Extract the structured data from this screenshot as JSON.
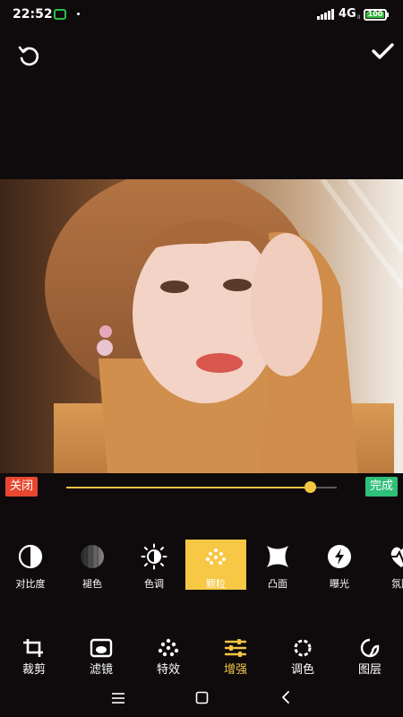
{
  "status": {
    "time": "22:52",
    "network": "4G",
    "network_sub": "II",
    "battery": "100",
    "battery_level": 1.0
  },
  "top_bar": {
    "undo_icon": "undo-icon",
    "confirm_icon": "check-icon"
  },
  "photo": {
    "description_icon": "photo-canvas"
  },
  "slider": {
    "close_label": "关闭",
    "done_label": "完成",
    "value": 0.9
  },
  "tools": [
    {
      "label": "对比度",
      "icon": "contrast-icon"
    },
    {
      "label": "褪色",
      "icon": "fade-icon"
    },
    {
      "label": "色调",
      "icon": "tone-icon"
    },
    {
      "label": "颗粒",
      "icon": "grain-icon",
      "active": true
    },
    {
      "label": "凸面",
      "icon": "convex-icon"
    },
    {
      "label": "曝光",
      "icon": "exposure-icon"
    },
    {
      "label": "氛围",
      "icon": "ambience-icon"
    }
  ],
  "nav": [
    {
      "label": "裁剪",
      "icon": "crop-icon"
    },
    {
      "label": "滤镜",
      "icon": "filter-icon"
    },
    {
      "label": "特效",
      "icon": "effects-icon"
    },
    {
      "label": "增强",
      "icon": "enhance-icon",
      "active": true
    },
    {
      "label": "调色",
      "icon": "color-icon"
    },
    {
      "label": "图层",
      "icon": "layer-icon"
    }
  ],
  "colors": {
    "accent": "#f3c642",
    "close": "#e8462f",
    "done": "#2fc07a",
    "background": "#0f0b0d"
  }
}
